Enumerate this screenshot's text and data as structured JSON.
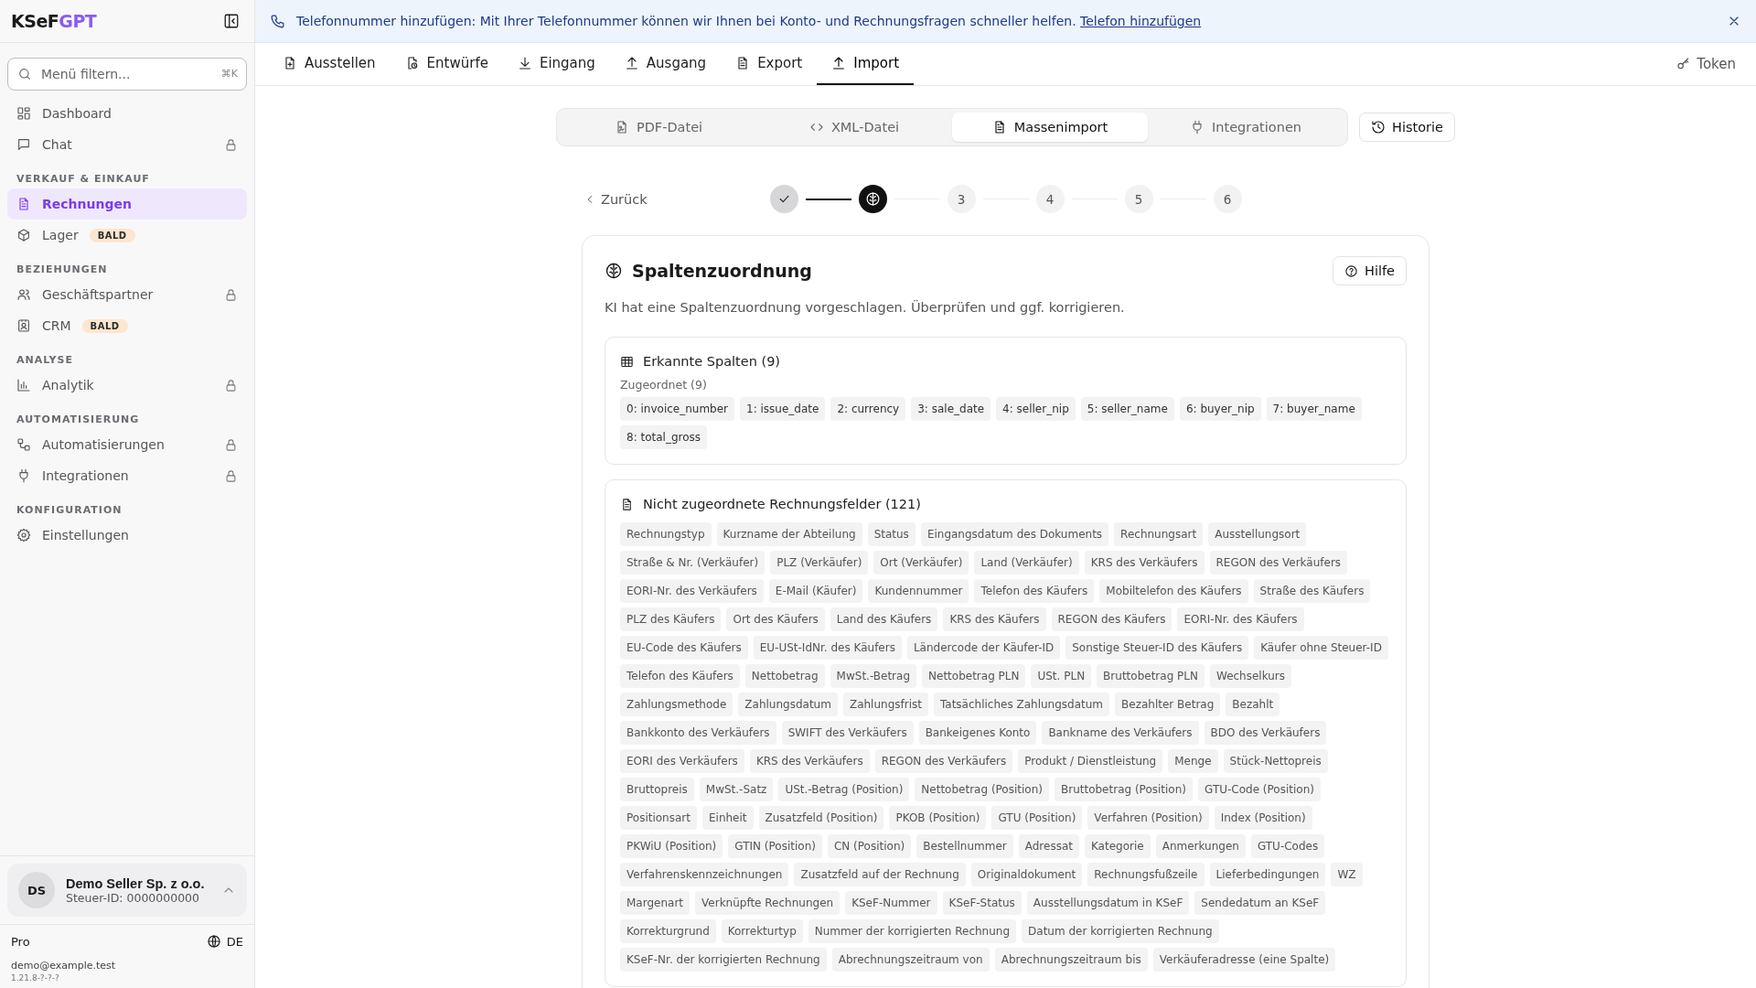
{
  "logo": {
    "prefix": "KSeF",
    "suffix": "GPT"
  },
  "menu_filter": {
    "placeholder": "Menü filtern...",
    "shortcut": "⌘K"
  },
  "sidebar": {
    "groups": [
      {
        "items": [
          {
            "label": "Dashboard",
            "selected": false,
            "locked": false
          },
          {
            "label": "Chat",
            "selected": false,
            "locked": true
          }
        ]
      },
      {
        "heading": "VERKAUF & EINKAUF",
        "items": [
          {
            "label": "Rechnungen",
            "selected": true,
            "locked": false
          },
          {
            "label": "Lager",
            "selected": false,
            "locked": false,
            "badge": "BALD"
          }
        ]
      },
      {
        "heading": "BEZIEHUNGEN",
        "items": [
          {
            "label": "Geschäftspartner",
            "selected": false,
            "locked": true
          },
          {
            "label": "CRM",
            "selected": false,
            "locked": false,
            "badge": "BALD"
          }
        ]
      },
      {
        "heading": "ANALYSE",
        "items": [
          {
            "label": "Analytik",
            "selected": false,
            "locked": true
          }
        ]
      },
      {
        "heading": "AUTOMATISIERUNG",
        "items": [
          {
            "label": "Automatisierungen",
            "selected": false,
            "locked": true
          },
          {
            "label": "Integrationen",
            "selected": false,
            "locked": true
          }
        ]
      },
      {
        "heading": "KONFIGURATION",
        "items": [
          {
            "label": "Einstellungen",
            "selected": false,
            "locked": false
          }
        ]
      }
    ]
  },
  "account": {
    "initials": "DS",
    "name": "Demo Seller Sp. z o.o.",
    "tax_id": "Steuer-ID: 0000000000"
  },
  "footer": {
    "plan": "Pro",
    "language": "DE",
    "email": "demo@example.test",
    "version": "1.21.8-?-?-?"
  },
  "banner": {
    "message": "Telefonnummer hinzufügen: Mit Ihrer Telefonnummer können wir Ihnen bei Konto- und Rechnungsfragen schneller helfen.",
    "link": "Telefon hinzufügen"
  },
  "tabs": [
    {
      "label": "Ausstellen",
      "selected": false
    },
    {
      "label": "Entwürfe",
      "selected": false
    },
    {
      "label": "Eingang",
      "selected": false
    },
    {
      "label": "Ausgang",
      "selected": false
    },
    {
      "label": "Export",
      "selected": false
    },
    {
      "label": "Import",
      "selected": true
    }
  ],
  "token_button": "Token",
  "import_modes": [
    {
      "label": "PDF-Datei",
      "selected": false
    },
    {
      "label": "XML-Datei",
      "selected": false
    },
    {
      "label": "Massenimport",
      "selected": true
    },
    {
      "label": "Integrationen",
      "selected": false
    }
  ],
  "history_button": "Historie",
  "back_link": "Zurück",
  "steps": [
    {
      "done": true,
      "current": false
    },
    {
      "done": false,
      "current": true
    },
    {
      "done": false,
      "current": false,
      "number": "3"
    },
    {
      "done": false,
      "current": false,
      "number": "4"
    },
    {
      "done": false,
      "current": false,
      "number": "5"
    },
    {
      "done": false,
      "current": false,
      "number": "6"
    }
  ],
  "card": {
    "title": "Spaltenzuordnung",
    "help_button": "Hilfe",
    "description": "KI hat eine Spaltenzuordnung vorgeschlagen. Überprüfen und ggf. korrigieren.",
    "detected": {
      "title": "Erkannte Spalten (9)",
      "subtitle": "Zugeordnet (9)",
      "chips": [
        "0: invoice_number",
        "1: issue_date",
        "2: currency",
        "3: sale_date",
        "4: seller_nip",
        "5: seller_name",
        "6: buyer_nip",
        "7: buyer_name",
        "8: total_gross"
      ]
    },
    "unassigned": {
      "title": "Nicht zugeordnete Rechnungsfelder (121)",
      "chips": [
        "Rechnungstyp",
        "Kurzname der Abteilung",
        "Status",
        "Eingangsdatum des Dokuments",
        "Rechnungsart",
        "Ausstellungsort",
        "Straße & Nr. (Verkäufer)",
        "PLZ (Verkäufer)",
        "Ort (Verkäufer)",
        "Land (Verkäufer)",
        "KRS des Verkäufers",
        "REGON des Verkäufers",
        "EORI-Nr. des Verkäufers",
        "E-Mail (Käufer)",
        "Kundennummer",
        "Telefon des Käufers",
        "Mobiltelefon des Käufers",
        "Straße des Käufers",
        "PLZ des Käufers",
        "Ort des Käufers",
        "Land des Käufers",
        "KRS des Käufers",
        "REGON des Käufers",
        "EORI-Nr. des Käufers",
        "EU-Code des Käufers",
        "EU-USt-IdNr. des Käufers",
        "Ländercode der Käufer-ID",
        "Sonstige Steuer-ID des Käufers",
        "Käufer ohne Steuer-ID",
        "Telefon des Käufers",
        "Nettobetrag",
        "MwSt.-Betrag",
        "Nettobetrag PLN",
        "USt. PLN",
        "Bruttobetrag PLN",
        "Wechselkurs",
        "Zahlungsmethode",
        "Zahlungsdatum",
        "Zahlungsfrist",
        "Tatsächliches Zahlungsdatum",
        "Bezahlter Betrag",
        "Bezahlt",
        "Bankkonto des Verkäufers",
        "SWIFT des Verkäufers",
        "Bankeigenes Konto",
        "Bankname des Verkäufers",
        "BDO des Verkäufers",
        "EORI des Verkäufers",
        "KRS des Verkäufers",
        "REGON des Verkäufers",
        "Produkt / Dienstleistung",
        "Menge",
        "Stück-Nettopreis",
        "Bruttopreis",
        "MwSt.-Satz",
        "USt.-Betrag (Position)",
        "Nettobetrag (Position)",
        "Bruttobetrag (Position)",
        "GTU-Code (Position)",
        "Positionsart",
        "Einheit",
        "Zusatzfeld (Position)",
        "PKOB (Position)",
        "GTU (Position)",
        "Verfahren (Position)",
        "Index (Position)",
        "PKWiU (Position)",
        "GTIN (Position)",
        "CN (Position)",
        "Bestellnummer",
        "Adressat",
        "Kategorie",
        "Anmerkungen",
        "GTU-Codes",
        "Verfahrenskennzeichnungen",
        "Zusatzfeld auf der Rechnung",
        "Originaldokument",
        "Rechnungsfußzeile",
        "Lieferbedingungen",
        "WZ",
        "Margenart",
        "Verknüpfte Rechnungen",
        "KSeF-Nummer",
        "KSeF-Status",
        "Ausstellungsdatum in KSeF",
        "Sendedatum an KSeF",
        "Korrekturgrund",
        "Korrekturtyp",
        "Nummer der korrigierten Rechnung",
        "Datum der korrigierten Rechnung",
        "KSeF-Nr. der korrigierten Rechnung",
        "Abrechnungszeitraum von",
        "Abrechnungszeitraum bis",
        "Verkäuferadresse (eine Spalte)"
      ]
    }
  }
}
